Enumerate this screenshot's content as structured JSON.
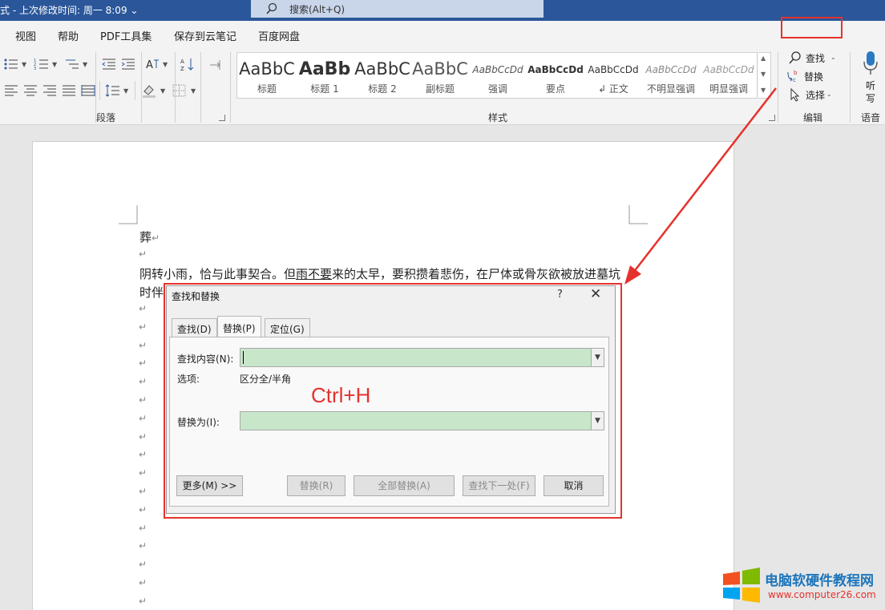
{
  "titlebar": {
    "title": "式 - 上次修改时间: 周一 8:09 ⌄",
    "search_placeholder": "搜索(Alt+Q)"
  },
  "menu": {
    "tabs": [
      "视图",
      "帮助",
      "PDF工具集",
      "保存到云笔记",
      "百度网盘"
    ]
  },
  "ribbon": {
    "paragraph_group": "段落",
    "styles_group": "样式",
    "editing_group": "编辑",
    "voice_group": "语音",
    "styles": [
      {
        "preview": "AaBbC",
        "name": "标题"
      },
      {
        "preview": "AaBb",
        "name": "标题 1"
      },
      {
        "preview": "AaBbC",
        "name": "标题 2"
      },
      {
        "preview": "AaBbC",
        "name": "副标题"
      },
      {
        "preview": "AaBbCcDd",
        "name": "强调"
      },
      {
        "preview": "AaBbCcDd",
        "name": "要点"
      },
      {
        "preview": "AaBbCcDd",
        "name": "↲ 正文"
      },
      {
        "preview": "AaBbCcDd",
        "name": "不明显强调"
      },
      {
        "preview": "AaBbCcDd",
        "name": "明显强调"
      }
    ],
    "find": "查找",
    "replace": "替换",
    "select": "选择",
    "dictate_1": "听",
    "dictate_2": "写"
  },
  "document": {
    "line1": "葬",
    "line2_a": "阴转小雨，恰与此事契合。但",
    "line2_b": "雨不要",
    "line2_c": "来的太早，要积攒着悲伤，在尸体或骨灰欲被放进墓坑",
    "line3": "时伴",
    "para_mark": "↵"
  },
  "dialog": {
    "title": "查找和替换",
    "help": "?",
    "close": "✕",
    "tabs": [
      "查找(D)",
      "替换(P)",
      "定位(G)"
    ],
    "find_label": "查找内容(N):",
    "find_value": "",
    "options_label": "选项:",
    "options_value": "区分全/半角",
    "replace_label": "替换为(I):",
    "replace_value": "",
    "more_button": "更多(M) >>",
    "replace_button": "替换(R)",
    "replace_all_button": "全部替换(A)",
    "find_next_button": "查找下一处(F)",
    "cancel_button": "取消"
  },
  "annotation": {
    "hotkey": "Ctrl+H",
    "accent_color": "#e5322d"
  },
  "watermark": {
    "name": "电脑软硬件教程网",
    "url": "www.computer26.com"
  }
}
